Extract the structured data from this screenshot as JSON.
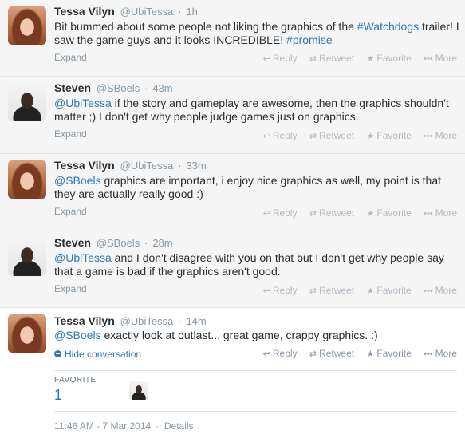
{
  "colors": {
    "link": "#2b7bb9",
    "muted": "#8899a6",
    "bg_stream": "#f5f5f5"
  },
  "tweets": [
    {
      "name": "Tessa Vilyn",
      "handle": "@UbiTessa",
      "time": "1h",
      "segments": [
        "Bit bummed about some people not liking the graphics of the ",
        "#Watchdogs",
        " trailer! I saw the game guys and it looks INCREDIBLE! ",
        "#promise"
      ],
      "expand": "Expand"
    },
    {
      "name": "Steven",
      "handle": "@SBoels",
      "time": "43m",
      "segments": [
        "@UbiTessa",
        " if the story and gameplay are awesome, then the graphics shouldn't matter ;) I don't get why people judge games just on graphics."
      ],
      "expand": "Expand"
    },
    {
      "name": "Tessa Vilyn",
      "handle": "@UbiTessa",
      "time": "33m",
      "segments": [
        "@SBoels",
        " graphics are important, i enjoy nice graphics as well, my point is that they are actually really good  :)"
      ],
      "expand": "Expand"
    },
    {
      "name": "Steven",
      "handle": "@SBoels",
      "time": "28m",
      "segments": [
        "@UbiTessa",
        " and I don't disagree with you on that but I don't get why people say that a game is bad if the graphics aren't good."
      ],
      "expand": "Expand"
    },
    {
      "name": "Tessa Vilyn",
      "handle": "@UbiTessa",
      "time": "14m",
      "segments": [
        "@SBoels",
        " exactly look at outlast... great game, crappy graphics. :)"
      ],
      "hide_conversation": "Hide conversation"
    }
  ],
  "actions": {
    "reply": "Reply",
    "retweet": "Retweet",
    "favorite": "Favorite",
    "more": "More"
  },
  "icons": {
    "reply": "reply-arrow-icon",
    "retweet": "retweet-icon",
    "favorite": "star-icon",
    "more": "ellipsis-icon",
    "hide": "minus-circle-icon"
  },
  "stats": {
    "favorite_label": "FAVORITE",
    "favorite_count": "1"
  },
  "footer": {
    "timestamp": "11:46 AM - 7 Mar 2014",
    "separator": "·",
    "details": "Details"
  }
}
